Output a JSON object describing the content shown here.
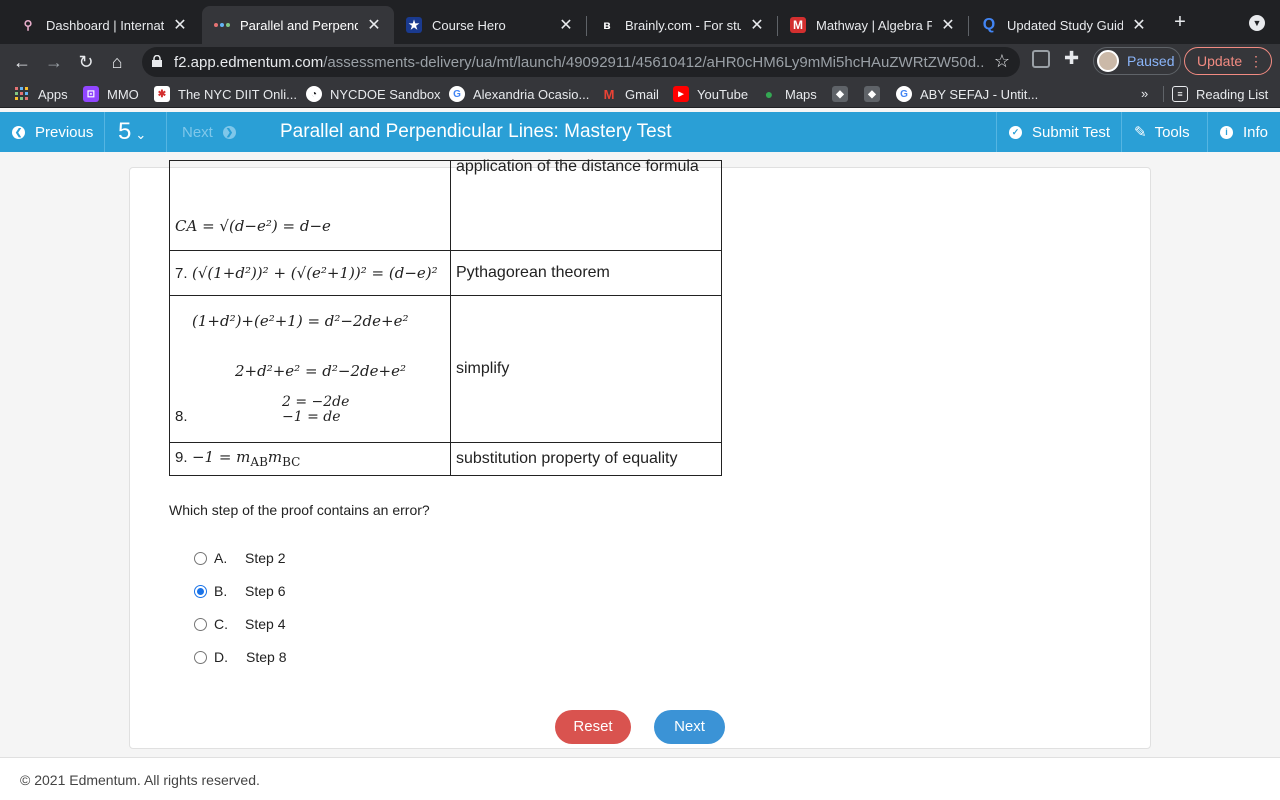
{
  "browser": {
    "tabs": [
      {
        "title": "Dashboard | Internatio",
        "favicon": "location-pin-icon"
      },
      {
        "title": "Parallel and Perpendic",
        "favicon": "edmentum-icon"
      },
      {
        "title": "Course Hero",
        "favicon": "star-icon"
      },
      {
        "title": "Brainly.com - For stud",
        "favicon": "brainly-icon"
      },
      {
        "title": "Mathway | Algebra Pro",
        "favicon": "mathway-icon"
      },
      {
        "title": "Updated Study Guide",
        "favicon": "quizlet-icon"
      }
    ],
    "url_host": "f2.app.edmentum.com",
    "url_path": "/assessments-delivery/ua/mt/launch/49092911/45610412/aHR0cHM6Ly9mMi5hcHAuZWRtZW50d...",
    "profile_status": "Paused",
    "update_label": "Update",
    "bookmarks": [
      "Apps",
      "MMO",
      "The NYC DIIT Onli...",
      "NYCDOE Sandbox",
      "Alexandria Ocasio...",
      "Gmail",
      "YouTube",
      "Maps",
      "ABY SEFAJ - Untit..."
    ],
    "bookmarks_more": "»",
    "reading_list": "Reading List"
  },
  "app": {
    "previous_label": "Previous",
    "question_number": "5",
    "next_label": "Next",
    "test_title": "Parallel and Perpendicular Lines: Mastery Test",
    "submit_label": "Submit Test",
    "tools_label": "Tools",
    "info_label": "Info"
  },
  "proof": {
    "partial_reason": "application of the distance formula",
    "step6_ca": "CA = √(d−e²) = d−e",
    "step7": {
      "number": "7.",
      "statement": "(√(1+d²))² + (√(e²+1))² = (d−e)²",
      "reason": "Pythagorean theorem"
    },
    "step8": {
      "number": "8.",
      "lines": [
        "(1+d²)+(e²+1) = d²−2de+e²",
        "2+d²+e² = d²−2de+e²",
        "2 = −2de",
        "−1 = de"
      ],
      "reason": "simplify"
    },
    "step9": {
      "number": "9.",
      "statement": "−1 = m",
      "sub1": "AB",
      "mid": "m",
      "sub2": "BC",
      "reason": "substitution property of equality"
    }
  },
  "question": "Which step of the proof contains an error?",
  "choices": [
    {
      "letter": "A.",
      "text": "Step 2",
      "selected": false
    },
    {
      "letter": "B.",
      "text": "Step 6",
      "selected": true
    },
    {
      "letter": "C.",
      "text": "Step 4",
      "selected": false
    },
    {
      "letter": "D.",
      "text": "Step 8",
      "selected": false
    }
  ],
  "buttons": {
    "reset": "Reset",
    "next": "Next"
  },
  "footer": "© 2021 Edmentum. All rights reserved."
}
